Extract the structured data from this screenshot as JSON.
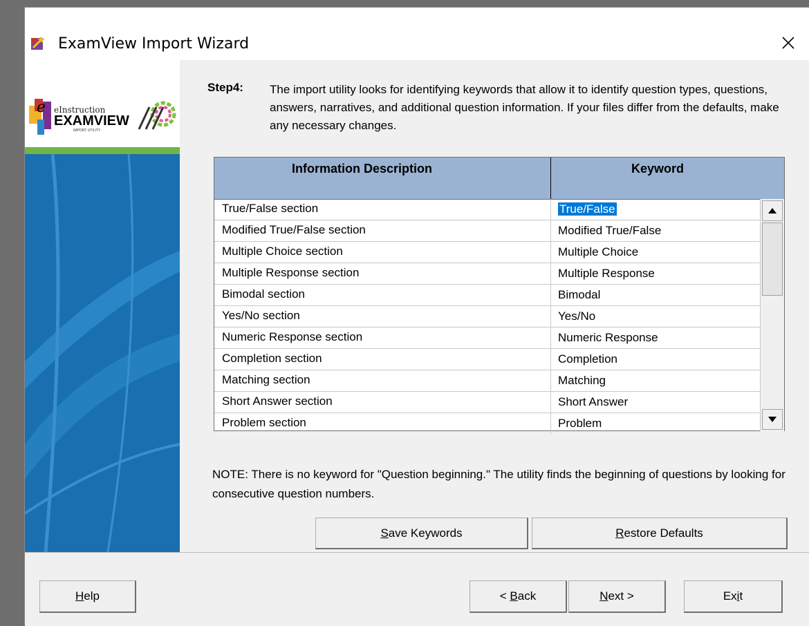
{
  "window": {
    "title": "ExamView Import Wizard"
  },
  "logo": {
    "brand_top": "eInstruction",
    "brand_main": "EXAMVIEW",
    "brand_sub": "IMPORT UTILITY"
  },
  "step": {
    "label": "Step4:",
    "text": "The import utility looks for identifying keywords that allow it to identify question types, questions, answers, narratives, and additional question information.  If your files differ from the defaults, make any necessary changes."
  },
  "grid": {
    "col_desc": "Information Description",
    "col_key": "Keyword",
    "rows": [
      {
        "desc": "True/False section",
        "key": "True/False",
        "selected": true
      },
      {
        "desc": "Modified True/False section",
        "key": "Modified True/False"
      },
      {
        "desc": "Multiple Choice section",
        "key": "Multiple Choice"
      },
      {
        "desc": "Multiple Response section",
        "key": "Multiple Response"
      },
      {
        "desc": "Bimodal section",
        "key": "Bimodal"
      },
      {
        "desc": "Yes/No section",
        "key": "Yes/No"
      },
      {
        "desc": "Numeric Response section",
        "key": "Numeric Response"
      },
      {
        "desc": "Completion section",
        "key": "Completion"
      },
      {
        "desc": "Matching section",
        "key": "Matching"
      },
      {
        "desc": "Short Answer section",
        "key": "Short Answer"
      },
      {
        "desc": "Problem section",
        "key": "Problem"
      }
    ]
  },
  "note": "NOTE: There is no keyword for \"Question beginning.\"  The utility finds the beginning of questions by looking for consecutive question numbers.",
  "buttons": {
    "save_keywords": {
      "mn": "S",
      "rest": "ave Keywords"
    },
    "restore_defaults": {
      "mn": "R",
      "rest": "estore Defaults"
    },
    "help": {
      "mn": "H",
      "rest": "elp"
    },
    "back": {
      "pre": "< ",
      "mn": "B",
      "rest": "ack"
    },
    "next": {
      "mn": "N",
      "rest": "ext >"
    },
    "exit": {
      "pre": "Ex",
      "mn": "i",
      "rest": "t"
    }
  },
  "colors": {
    "header_bg": "#9bb3d3",
    "sidebar_blue": "#1a6fb0",
    "accent_green": "#6fb548",
    "selection": "#0078d7"
  }
}
